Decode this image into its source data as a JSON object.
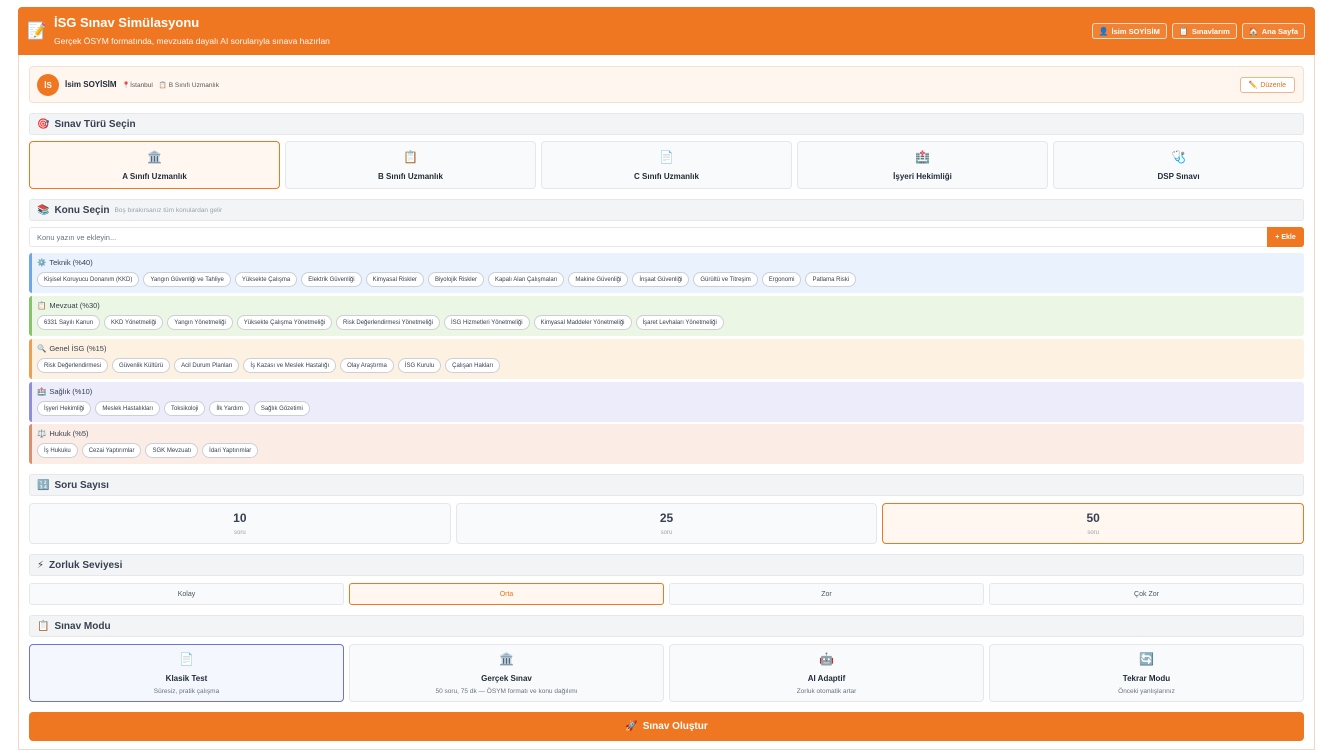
{
  "header": {
    "title": "İSG Sınav Simülasyonu",
    "subtitle": "Gerçek ÖSYM formatında, mevzuata dayalı AI sorularıyla sınava hazırlan",
    "buttons": [
      {
        "icon": "👤",
        "label": "İsim SOYİSİM"
      },
      {
        "icon": "📋",
        "label": "Sınavlarım"
      },
      {
        "icon": "🏠",
        "label": "Ana Sayfa"
      }
    ]
  },
  "profile": {
    "initials": "İS",
    "name": "İsim SOYİSİM",
    "city": "İstanbul",
    "city_icon": "📍",
    "cert": "B Sınıfı Uzmanlık",
    "cert_icon": "📋",
    "edit_label": "Düzenle",
    "edit_icon": "✏️"
  },
  "exam_type": {
    "icon": "🎯",
    "title": "Sınav Türü Seçin",
    "options": [
      {
        "icon": "🏛️",
        "label": "A Sınıfı Uzmanlık"
      },
      {
        "icon": "📋",
        "label": "B Sınıfı Uzmanlık"
      },
      {
        "icon": "📄",
        "label": "C Sınıfı Uzmanlık"
      },
      {
        "icon": "🏥",
        "label": "İşyeri Hekimliği"
      },
      {
        "icon": "🩺",
        "label": "DSP Sınavı"
      }
    ],
    "selected": "A Sınıfı Uzmanlık"
  },
  "topics": {
    "icon": "📚",
    "title": "Konu Seçin",
    "hint": "Boş bırakırsanız tüm konulardan gelir",
    "input_placeholder": "Konu yazın ve ekleyin...",
    "add_label": "+ Ekle",
    "categories": [
      {
        "icon": "⚙️",
        "name": "Teknik (%40)",
        "bg": "#e9f2fd",
        "border": "#6fa7e6",
        "chips": [
          "Kişisel Koruyucu Donanım (KKD)",
          "Yangın Güvenliği ve Tahliye",
          "Yüksekte Çalışma",
          "Elektrik Güvenliği",
          "Kimyasal Riskler",
          "Biyolojik Riskler",
          "Kapalı Alan Çalışmaları",
          "Makine Güvenliği",
          "İnşaat Güvenliği",
          "Gürültü ve Titreşim",
          "Ergonomi",
          "Patlama Riski"
        ]
      },
      {
        "icon": "📋",
        "name": "Mevzuat (%30)",
        "bg": "#ebf6e4",
        "border": "#86c46a",
        "chips": [
          "6331 Sayılı Kanun",
          "KKD Yönetmeliği",
          "Yangın Yönetmeliği",
          "Yüksekte Çalışma Yönetmeliği",
          "Risk Değerlendirmesi Yönetmeliği",
          "İSG Hizmetleri Yönetmeliği",
          "Kimyasal Maddeler Yönetmeliği",
          "İşaret Levhaları Yönetmeliği"
        ]
      },
      {
        "icon": "🔍",
        "name": "Genel İSG (%15)",
        "bg": "#fdf1e2",
        "border": "#eba155",
        "chips": [
          "Risk Değerlendirmesi",
          "Güvenlik Kültürü",
          "Acil Durum Planları",
          "İş Kazası ve Meslek Hastalığı",
          "Olay Araştırma",
          "İSG Kurulu",
          "Çalışan Hakları"
        ]
      },
      {
        "icon": "🏥",
        "name": "Sağlık (%10)",
        "bg": "#ececfb",
        "border": "#8f8fd9",
        "chips": [
          "İşyeri Hekimliği",
          "Meslek Hastalıkları",
          "Toksikoloji",
          "İlk Yardım",
          "Sağlık Gözetimi"
        ]
      },
      {
        "icon": "⚖️",
        "name": "Hukuk (%5)",
        "bg": "#fbece6",
        "border": "#d9906f",
        "chips": [
          "İş Hukuku",
          "Cezai Yaptırımlar",
          "SGK Mevzuatı",
          "İdari Yaptırımlar"
        ]
      }
    ]
  },
  "question_count": {
    "icon": "🔢",
    "title": "Soru Sayısı",
    "unit": "soru",
    "options": [
      "10",
      "25",
      "50"
    ],
    "selected": "50"
  },
  "difficulty": {
    "icon": "⚡",
    "title": "Zorluk Seviyesi",
    "options": [
      "Kolay",
      "Orta",
      "Zor",
      "Çok Zor"
    ],
    "selected": "Orta"
  },
  "mode": {
    "icon": "📋",
    "title": "Sınav Modu",
    "options": [
      {
        "icon": "📄",
        "label": "Klasik Test",
        "desc": "Süresiz, pratik çalışma"
      },
      {
        "icon": "🏛️",
        "label": "Gerçek Sınav",
        "desc": "50 soru, 75 dk — ÖSYM formatı ve konu dağılımı"
      },
      {
        "icon": "🤖",
        "label": "AI Adaptif",
        "desc": "Zorluk otomatik artar"
      },
      {
        "icon": "🔄",
        "label": "Tekrar Modu",
        "desc": "Önceki yanlışlarınız"
      }
    ],
    "selected": "Klasik Test"
  },
  "create": {
    "icon": "🚀",
    "label": "Sınav Oluştur"
  }
}
